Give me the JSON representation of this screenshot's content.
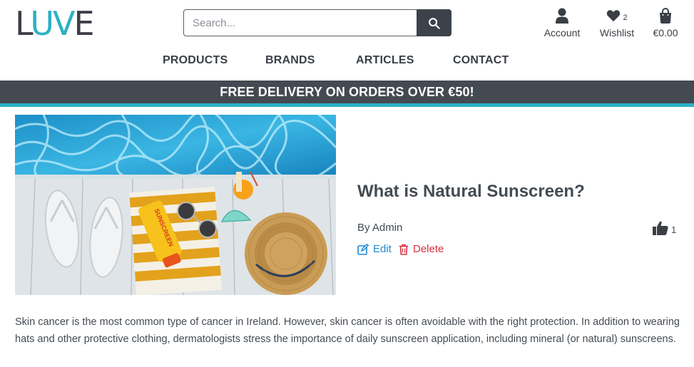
{
  "brand": {
    "logo_l": "L",
    "logo_uv": "UV",
    "logo_e": "E"
  },
  "search": {
    "placeholder": "Search..."
  },
  "toolbar": {
    "account_label": "Account",
    "wishlist_label": "Wishlist",
    "wishlist_count": "2",
    "cart_total": "€0.00"
  },
  "nav": {
    "items": [
      "PRODUCTS",
      "BRANDS",
      "ARTICLES",
      "CONTACT"
    ]
  },
  "banner": {
    "text": "FREE DELIVERY ON ORDERS OVER €50!"
  },
  "article": {
    "title": "What is Natural Sunscreen?",
    "author": "By Admin",
    "likes": "1",
    "edit_label": "Edit",
    "delete_label": "Delete",
    "image_text": "SUNSCREEN",
    "body": "Skin cancer is the most common type of cancer in Ireland. However, skin cancer is often avoidable with the right protection. In addition to wearing hats and other protective clothing, dermatologists stress the importance of daily sunscreen application, including mineral (or natural) sunscreens."
  },
  "colors": {
    "accent": "#2cb1c4",
    "dark": "#444a51",
    "edit": "#1c8ad6",
    "delete": "#d6303f"
  },
  "icons": [
    "search-icon",
    "user-icon",
    "heart-icon",
    "shopping-bag-icon",
    "thumbs-up-icon",
    "edit-icon",
    "trash-icon"
  ]
}
